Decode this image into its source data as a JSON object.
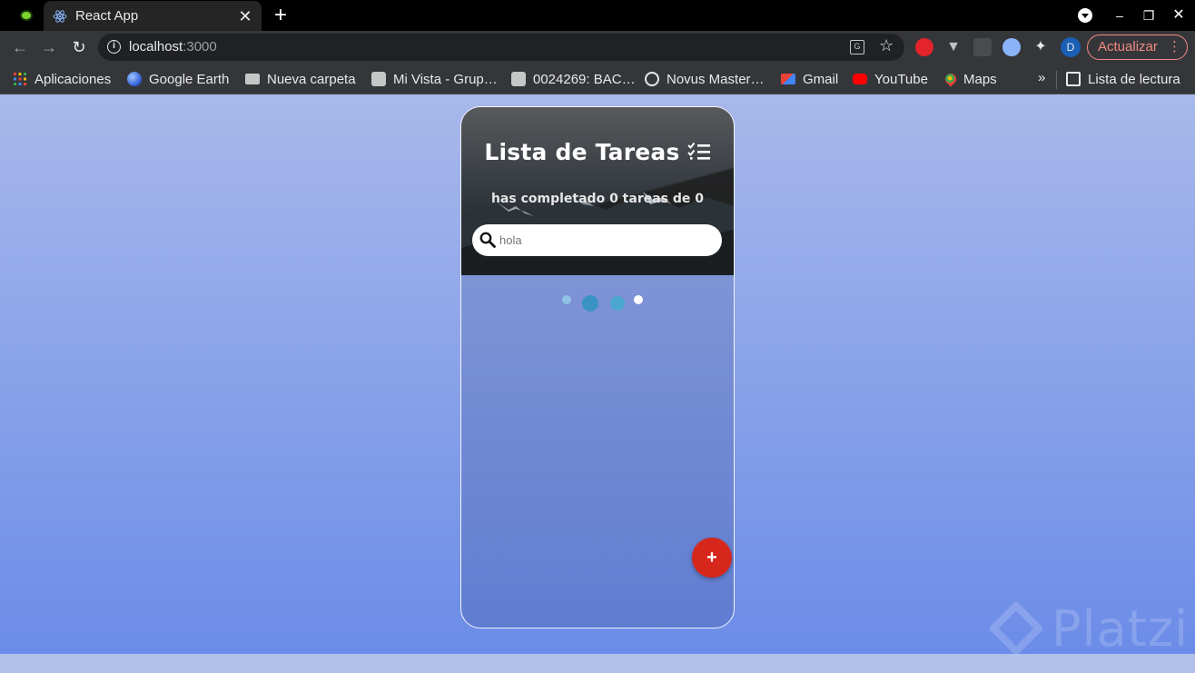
{
  "browser": {
    "tab": {
      "title": "React App",
      "close": "✕"
    },
    "new_tab": "+",
    "window": {
      "minimize": "–",
      "maximize": "❐",
      "close": "✕"
    },
    "address": {
      "host": "localhost",
      "port": ":3000"
    },
    "update_label": "Actualizar",
    "kebab": "⋮",
    "profile_initial": "D",
    "bookmarks": [
      {
        "label": "Aplicaciones",
        "icon": "apps-grid-icon"
      },
      {
        "label": "Google Earth",
        "icon": "google-earth-icon"
      },
      {
        "label": "Nueva carpeta",
        "icon": "folder-icon"
      },
      {
        "label": "Mi Vista - Grup…",
        "icon": "puzzle-icon"
      },
      {
        "label": "0024269: BAC…",
        "icon": "puzzle-icon"
      },
      {
        "label": "Novus Master…",
        "icon": "eye-icon"
      },
      {
        "label": "Gmail",
        "icon": "gmail-icon"
      },
      {
        "label": "YouTube",
        "icon": "youtube-icon"
      },
      {
        "label": "Maps",
        "icon": "maps-icon"
      }
    ],
    "bookmarks_overflow": "»",
    "reading_list": "Lista de lectura"
  },
  "app": {
    "title": "Lista de Tareas",
    "counter": "has completado 0 tareas de 0",
    "search": {
      "value": "hola",
      "placeholder": "hola"
    },
    "add_label": "+",
    "accent_color": "#d7261c"
  },
  "watermark": "Platzi"
}
